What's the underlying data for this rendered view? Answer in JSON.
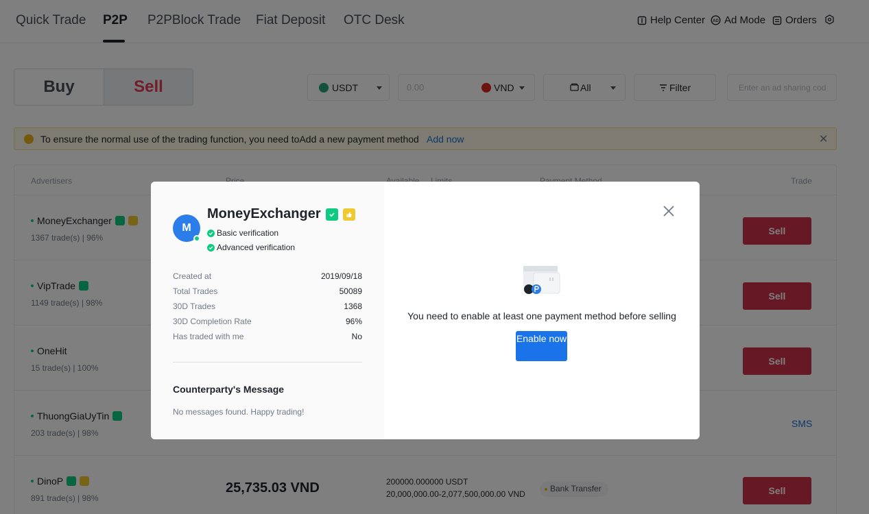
{
  "nav": {
    "tabs": [
      {
        "label": "Quick Trade"
      },
      {
        "label": "P2P"
      },
      {
        "label": "P2PBlock Trade"
      },
      {
        "label": "Fiat Deposit"
      },
      {
        "label": "OTC Desk"
      }
    ],
    "active_tab": "P2P",
    "help_center": "Help Center",
    "ad_mode": "Ad Mode",
    "orders": "Orders"
  },
  "trade_toggle": {
    "buy": "Buy",
    "sell": "Sell",
    "selected": "Sell"
  },
  "filters": {
    "coin": "USDT",
    "amount_placeholder": "0.00",
    "fiat": "VND",
    "payment": "All",
    "filter_label": "Filter",
    "ad_code_placeholder": "Enter an ad sharing cod"
  },
  "banner": {
    "text": "To ensure the normal use of the trading function, you need toAdd a new payment method",
    "link": "Add now"
  },
  "table": {
    "headers": [
      "Advertisers",
      "Price",
      "Available",
      "Limits",
      "Payment Method",
      "Trade"
    ],
    "rows": [
      {
        "name": "MoneyExchanger",
        "stats": "1367 trade(s) | 96%",
        "action": "Sell"
      },
      {
        "name": "VipTrade",
        "stats": "1149 trade(s) | 98%",
        "action": "Sell"
      },
      {
        "name": "OneHit",
        "stats": "15 trade(s) | 100%",
        "action": "Sell"
      },
      {
        "name": "ThuongGiaUyTin",
        "stats": "203 trade(s) | 98%",
        "action": "SMS"
      },
      {
        "name": "DinoP",
        "stats": "891 trade(s) | 98%",
        "price": "25,735.03 VND",
        "available": "200000.000000 USDT",
        "limits": "20,000,000.00-2,077,500,000.00 VND",
        "payment": "Bank Transfer",
        "action": "Sell"
      }
    ]
  },
  "modal": {
    "avatar_letter": "M",
    "name": "MoneyExchanger",
    "verifications": [
      "Basic verification",
      "Advanced verification"
    ],
    "stats": [
      {
        "label": "Created at",
        "value": "2019/09/18"
      },
      {
        "label": "Total Trades",
        "value": "50089"
      },
      {
        "label": "30D Trades",
        "value": "1368"
      },
      {
        "label": "30D Completion Rate",
        "value": "96%"
      },
      {
        "label": "Has traded with me",
        "value": "No"
      }
    ],
    "message_title": "Counterparty's Message",
    "message_body": "No messages found. Happy trading!",
    "notice": "You need to enable at least one payment method before selling",
    "enable_button": "Enable now"
  },
  "colors": {
    "sell": "#cf304a",
    "accent": "#1a73e8",
    "verified": "#0ecb81"
  }
}
